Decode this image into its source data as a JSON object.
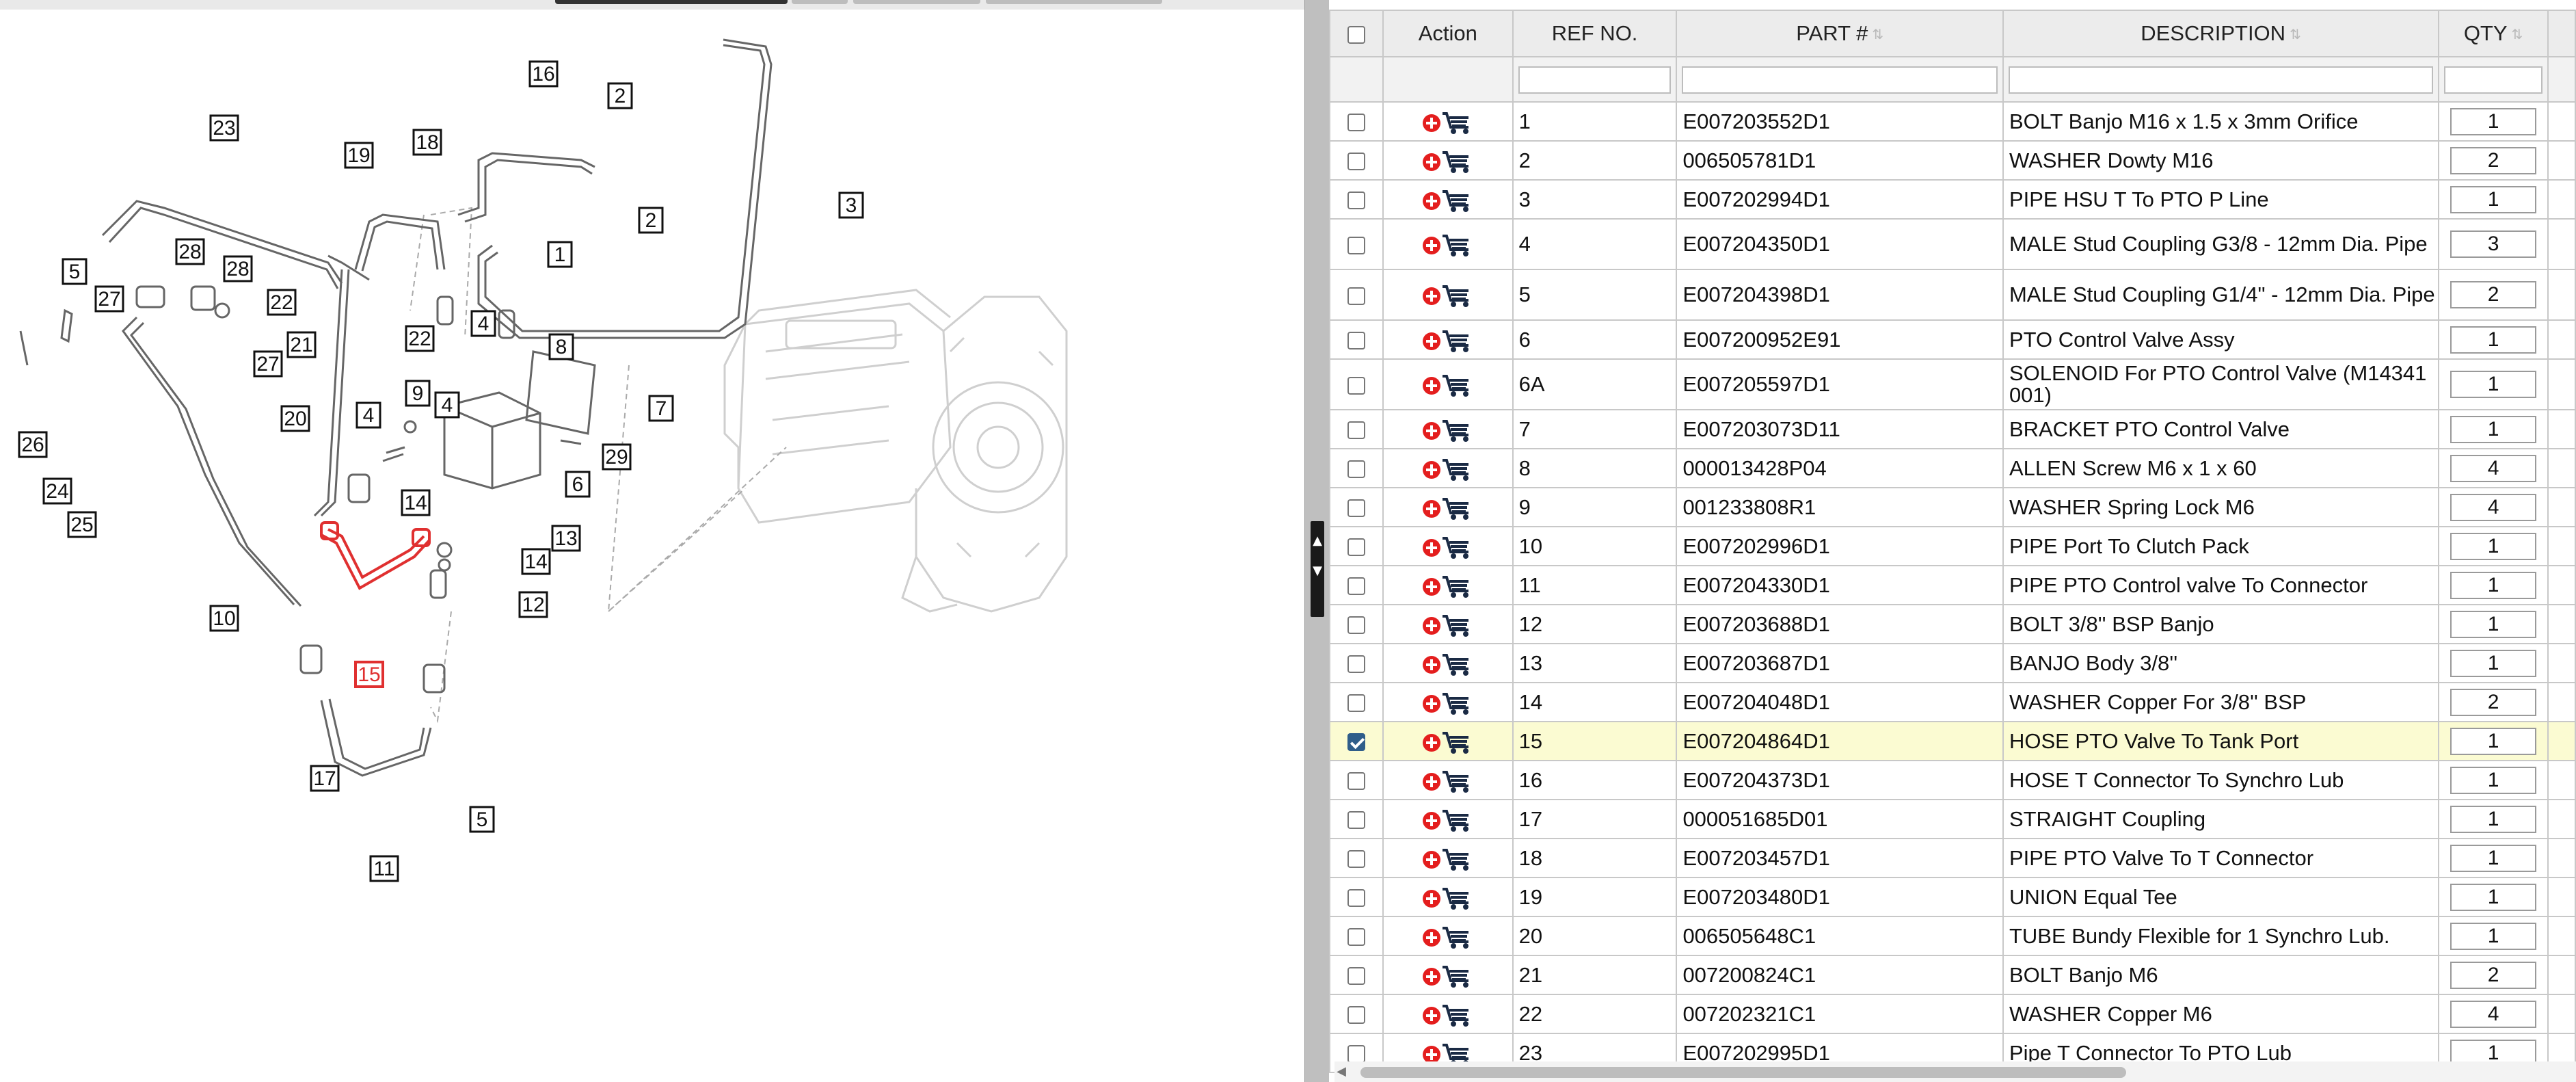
{
  "diagram": {
    "callouts": [
      "23",
      "19",
      "18",
      "16",
      "2",
      "2",
      "1",
      "3",
      "5",
      "27",
      "28",
      "28",
      "27",
      "22",
      "22",
      "21",
      "26",
      "24",
      "25",
      "20",
      "10",
      "4",
      "4",
      "8",
      "9",
      "4",
      "7",
      "6",
      "29",
      "14",
      "13",
      "14",
      "12",
      "15",
      "17",
      "11",
      "5"
    ]
  },
  "table": {
    "headers": {
      "action": "Action",
      "ref": "REF NO.",
      "part": "PART #",
      "description": "DESCRIPTION",
      "qty": "QTY"
    },
    "rows": [
      {
        "ref": "1",
        "part": "E007203552D1",
        "description": "BOLT Banjo M16 x 1.5 x 3mm Orifice",
        "qty": "1",
        "checked": false
      },
      {
        "ref": "2",
        "part": "006505781D1",
        "description": "WASHER Dowty M16",
        "qty": "2",
        "checked": false
      },
      {
        "ref": "3",
        "part": "E007202994D1",
        "description": "PIPE HSU T To PTO P Line",
        "qty": "1",
        "checked": false
      },
      {
        "ref": "4",
        "part": "E007204350D1",
        "description": "MALE Stud Coupling G3/8 - 12mm Dia. Pipe",
        "qty": "3",
        "checked": false
      },
      {
        "ref": "5",
        "part": "E007204398D1",
        "description": "MALE Stud Coupling G1/4\" - 12mm Dia. Pipe",
        "qty": "2",
        "checked": false
      },
      {
        "ref": "6",
        "part": "E007200952E91",
        "description": "PTO Control Valve Assy",
        "qty": "1",
        "checked": false
      },
      {
        "ref": "6A",
        "part": "E007205597D1",
        "description": "SOLENOID For PTO Control Valve (M14341001)",
        "qty": "1",
        "checked": false
      },
      {
        "ref": "7",
        "part": "E007203073D11",
        "description": "BRACKET PTO Control Valve",
        "qty": "1",
        "checked": false
      },
      {
        "ref": "8",
        "part": "000013428P04",
        "description": "ALLEN Screw M6 x 1 x 60",
        "qty": "4",
        "checked": false
      },
      {
        "ref": "9",
        "part": "001233808R1",
        "description": "WASHER Spring Lock M6",
        "qty": "4",
        "checked": false
      },
      {
        "ref": "10",
        "part": "E007202996D1",
        "description": "PIPE Port To Clutch Pack",
        "qty": "1",
        "checked": false
      },
      {
        "ref": "11",
        "part": "E007204330D1",
        "description": "PIPE PTO Control valve To Connector",
        "qty": "1",
        "checked": false
      },
      {
        "ref": "12",
        "part": "E007203688D1",
        "description": "BOLT 3/8'' BSP Banjo",
        "qty": "1",
        "checked": false
      },
      {
        "ref": "13",
        "part": "E007203687D1",
        "description": "BANJO Body 3/8''",
        "qty": "1",
        "checked": false
      },
      {
        "ref": "14",
        "part": "E007204048D1",
        "description": "WASHER Copper For 3/8'' BSP",
        "qty": "2",
        "checked": false
      },
      {
        "ref": "15",
        "part": "E007204864D1",
        "description": "HOSE PTO Valve To Tank Port",
        "qty": "1",
        "checked": true
      },
      {
        "ref": "16",
        "part": "E007204373D1",
        "description": "HOSE T Connector To Synchro Lub",
        "qty": "1",
        "checked": false
      },
      {
        "ref": "17",
        "part": "000051685D01",
        "description": "STRAIGHT Coupling",
        "qty": "1",
        "checked": false
      },
      {
        "ref": "18",
        "part": "E007203457D1",
        "description": "PIPE PTO Valve To T Connector",
        "qty": "1",
        "checked": false
      },
      {
        "ref": "19",
        "part": "E007203480D1",
        "description": "UNION Equal Tee",
        "qty": "1",
        "checked": false
      },
      {
        "ref": "20",
        "part": "006505648C1",
        "description": "TUBE Bundy Flexible for 1 Synchro Lub.",
        "qty": "1",
        "checked": false
      },
      {
        "ref": "21",
        "part": "007200824C1",
        "description": "BOLT Banjo M6",
        "qty": "2",
        "checked": false
      },
      {
        "ref": "22",
        "part": "007202321C1",
        "description": "WASHER Copper M6",
        "qty": "4",
        "checked": false
      },
      {
        "ref": "23",
        "part": "E007202995D1",
        "description": "Pipe T Connector To PTO Lub",
        "qty": "1",
        "checked": false
      }
    ]
  },
  "icons": {
    "add_to_cart": "add-to-cart-icon",
    "sort": "sort-arrows-icon",
    "collapse": "chevron-up-icon",
    "expand": "chevron-down-icon"
  },
  "colors": {
    "highlight_row": "#fbfbd2",
    "selected_part": "#e03030",
    "cart_red": "#e41e1e",
    "checkbox_checked": "#2f5d8a"
  }
}
